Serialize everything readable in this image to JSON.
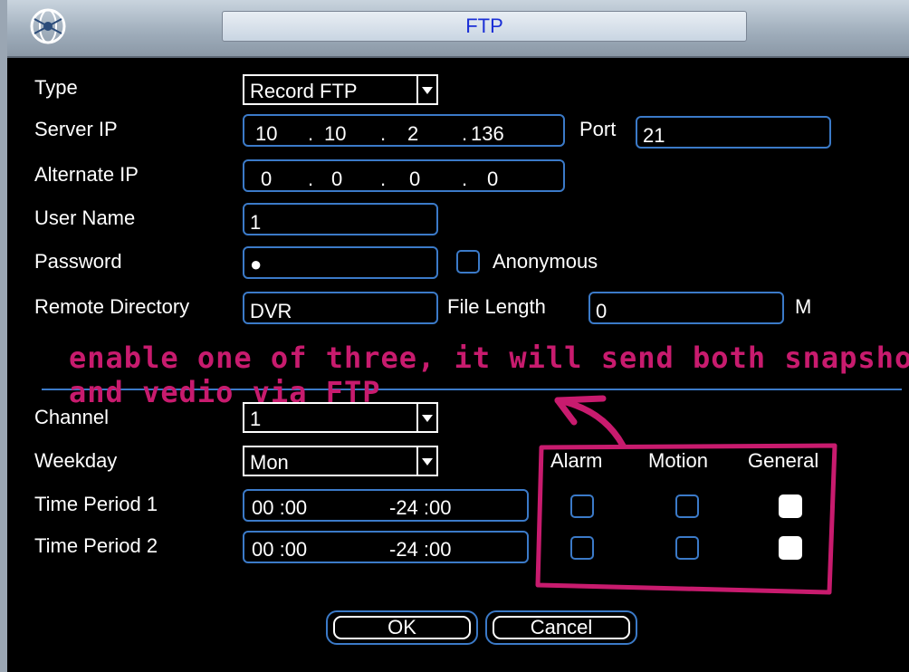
{
  "window": {
    "title": "FTP"
  },
  "form": {
    "type": {
      "label": "Type",
      "value": "Record FTP"
    },
    "server_ip": {
      "label": "Server IP",
      "octets": [
        "10",
        "10",
        "2",
        "136"
      ]
    },
    "port": {
      "label": "Port",
      "value": "21"
    },
    "alternate_ip": {
      "label": "Alternate IP",
      "octets": [
        "0",
        "0",
        "0",
        "0"
      ]
    },
    "user_name": {
      "label": "User Name",
      "value": "1"
    },
    "password": {
      "label": "Password",
      "value": "●"
    },
    "anonymous": {
      "label": "Anonymous",
      "checked": false
    },
    "remote_directory": {
      "label": "Remote Directory",
      "value": "DVR"
    },
    "file_length": {
      "label": "File Length",
      "value": "0",
      "unit": "M"
    }
  },
  "schedule": {
    "channel": {
      "label": "Channel",
      "value": "1"
    },
    "weekday": {
      "label": "Weekday",
      "value": "Mon"
    },
    "columns": [
      "Alarm",
      "Motion",
      "General"
    ],
    "periods": [
      {
        "label": "Time Period 1",
        "start": "00 :00",
        "end": "-24 :00",
        "alarm": false,
        "motion": false,
        "general": true
      },
      {
        "label": "Time Period 2",
        "start": "00 :00",
        "end": "-24 :00",
        "alarm": false,
        "motion": false,
        "general": true
      }
    ]
  },
  "buttons": {
    "ok": "OK",
    "cancel": "Cancel"
  },
  "annotation": {
    "line1": "enable one of three, it will send both snapshot",
    "line2": "and vedio via FTP",
    "color": "#c81b6e"
  },
  "colors": {
    "accent": "#3b7ac8",
    "title_text": "#1b2fd6"
  }
}
